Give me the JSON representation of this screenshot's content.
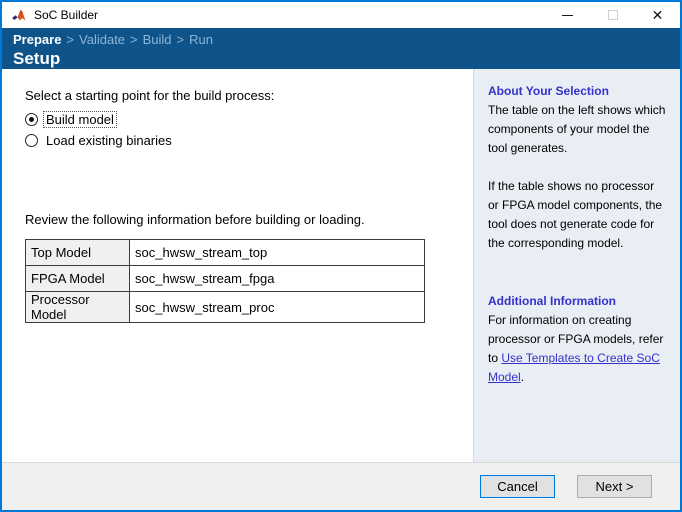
{
  "colors": {
    "window_border": "#0078d7",
    "header_bg": "#0e548a",
    "breadcrumb_inactive": "#8db4d4",
    "sidebar_bg": "#e9edf4",
    "help_blue": "#3333cc",
    "table_key_bg": "#f0f0f0",
    "footer_bg": "#f0f0f0"
  },
  "titlebar": {
    "title": "SoC Builder",
    "close_glyph": "✕"
  },
  "breadcrumb": {
    "separator": ">",
    "steps": [
      "Prepare",
      "Validate",
      "Build",
      "Run"
    ],
    "active_step": "Prepare"
  },
  "page_title": "Setup",
  "main": {
    "prompt": "Select a starting point for the build process:",
    "radios": [
      {
        "label": "Build model",
        "selected": true
      },
      {
        "label": "Load existing binaries",
        "selected": false
      }
    ],
    "review_text": "Review the following information before building or loading.",
    "table": {
      "rows": [
        {
          "label": "Top Model",
          "value": "soc_hwsw_stream_top"
        },
        {
          "label": "FPGA Model",
          "value": "soc_hwsw_stream_fpga"
        },
        {
          "label": "Processor Model",
          "value": "soc_hwsw_stream_proc"
        }
      ]
    }
  },
  "sidebar": {
    "about": {
      "heading": "About Your Selection",
      "paragraph1": "The table on the left shows which components of your model the tool generates.",
      "paragraph2": "If the table shows no processor or FPGA model components, the tool does not generate code for the corresponding model."
    },
    "additional": {
      "heading": "Additional Information",
      "text_before_link": "For information on creating processor or FPGA models, refer to ",
      "link_text": "Use Templates to Create SoC Model",
      "text_after_link": "."
    }
  },
  "footer": {
    "cancel_label": "Cancel",
    "next_label": "Next >"
  }
}
